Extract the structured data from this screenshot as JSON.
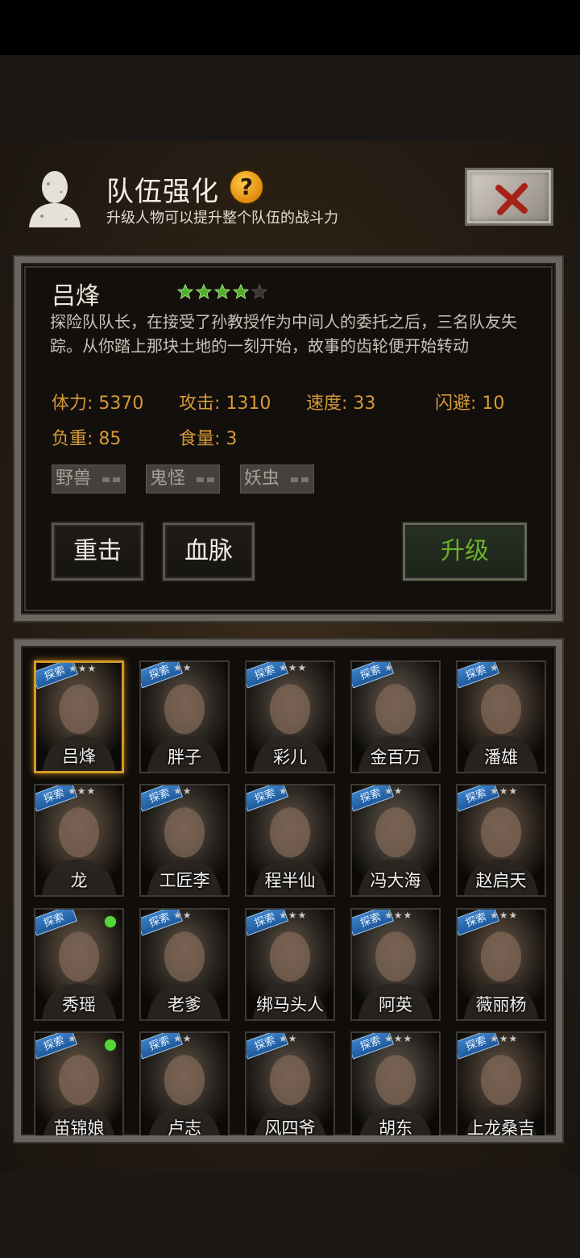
{
  "header": {
    "title": "队伍强化",
    "subtitle": "升级人物可以提升整个队伍的战斗力"
  },
  "character": {
    "name": "吕烽",
    "stars": 4,
    "max_stars": 5,
    "description": "探险队队长，在接受了孙教授作为中间人的委托之后，三名队友失踪。从你踏上那块土地的一刻开始，故事的齿轮便开始转动",
    "stats": {
      "stamina": "体力: 5370",
      "attack": "攻击: 1310",
      "speed": "速度: 33",
      "dodge": "闪避: 10",
      "load": "负重: 85",
      "food": "食量: 3"
    },
    "tags": [
      "野兽",
      "鬼怪",
      "妖虫"
    ],
    "skills": [
      "重击",
      "血脉"
    ],
    "upgrade_label": "升级"
  },
  "roster": {
    "badge_label": "探索",
    "cards": [
      {
        "name": "吕烽",
        "stars": 3,
        "selected": true,
        "dot": false
      },
      {
        "name": "胖子",
        "stars": 2,
        "selected": false,
        "dot": false
      },
      {
        "name": "彩儿",
        "stars": 3,
        "selected": false,
        "dot": false
      },
      {
        "name": "金百万",
        "stars": 1,
        "selected": false,
        "dot": false
      },
      {
        "name": "潘雄",
        "stars": 1,
        "selected": false,
        "dot": false
      },
      {
        "name": "龙",
        "stars": 3,
        "selected": false,
        "dot": false
      },
      {
        "name": "工匠李",
        "stars": 2,
        "selected": false,
        "dot": false
      },
      {
        "name": "程半仙",
        "stars": 1,
        "selected": false,
        "dot": false
      },
      {
        "name": "冯大海",
        "stars": 2,
        "selected": false,
        "dot": false
      },
      {
        "name": "赵启天",
        "stars": 3,
        "selected": false,
        "dot": false
      },
      {
        "name": "秀瑶",
        "stars": 0,
        "selected": false,
        "dot": true
      },
      {
        "name": "老爹",
        "stars": 2,
        "selected": false,
        "dot": false
      },
      {
        "name": "绑马头人",
        "stars": 3,
        "selected": false,
        "dot": false
      },
      {
        "name": "阿英",
        "stars": 3,
        "selected": false,
        "dot": false
      },
      {
        "name": "薇丽杨",
        "stars": 3,
        "selected": false,
        "dot": false
      },
      {
        "name": "苗锦娘",
        "stars": 1,
        "selected": false,
        "dot": true
      },
      {
        "name": "卢志",
        "stars": 2,
        "selected": false,
        "dot": false
      },
      {
        "name": "风四爷",
        "stars": 2,
        "selected": false,
        "dot": false
      },
      {
        "name": "胡东",
        "stars": 3,
        "selected": false,
        "dot": false
      },
      {
        "name": "上龙桑吉",
        "stars": 3,
        "selected": false,
        "dot": false
      }
    ]
  },
  "colors": {
    "accent_orange": "#d69a38",
    "upgrade_green": "#6db02a",
    "selected_border": "#d49a2a"
  },
  "icons": {
    "help": "question-icon",
    "close": "close-x-icon",
    "avatar": "person-silhouette-icon"
  }
}
